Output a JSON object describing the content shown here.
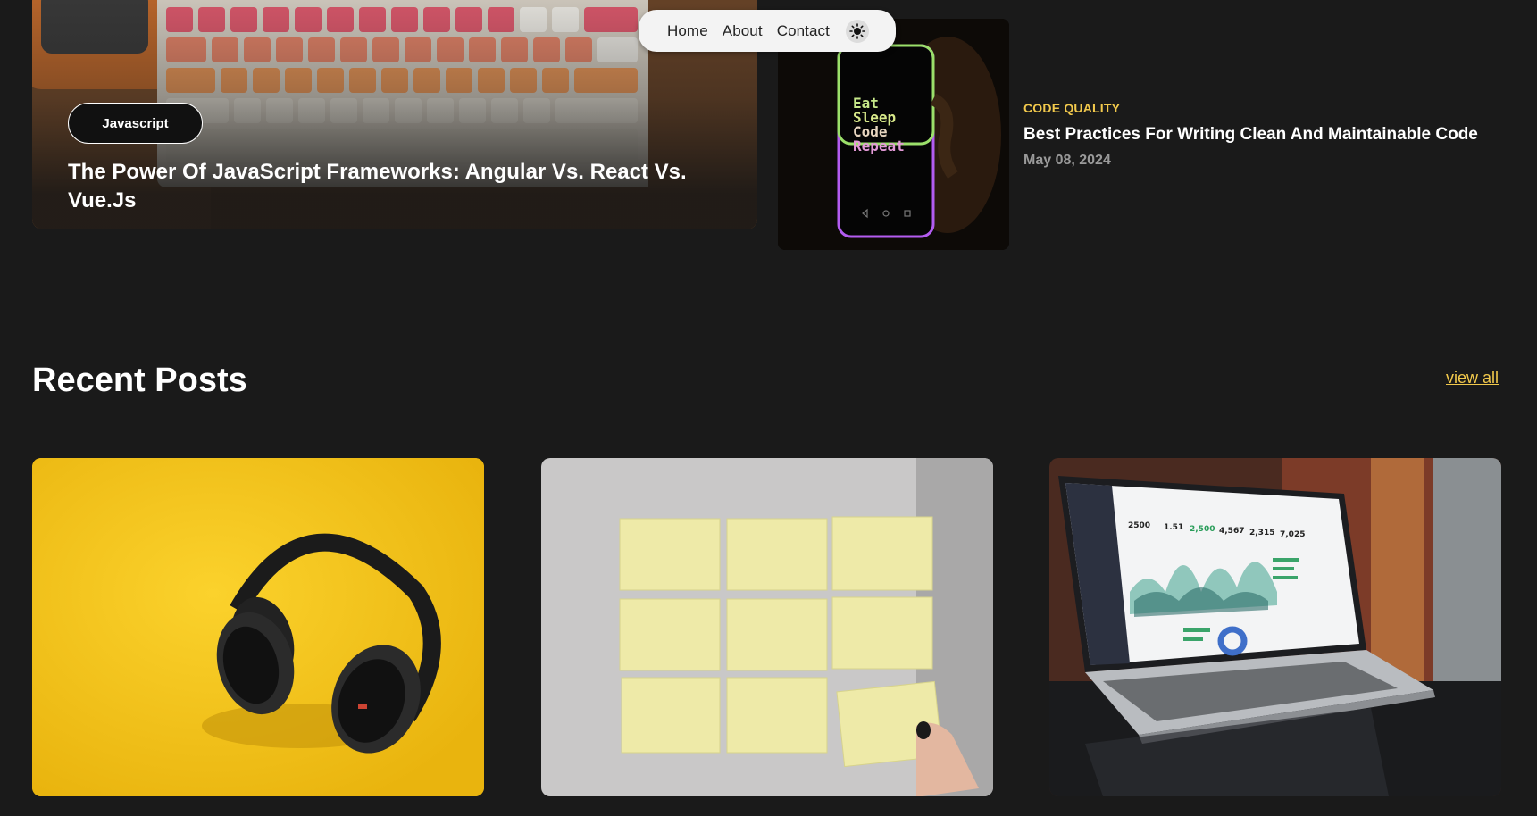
{
  "nav": {
    "items": [
      "Home",
      "About",
      "Contact"
    ],
    "theme_toggle_icon": "sun-icon"
  },
  "featured": {
    "tag": "Javascript",
    "title": "The Power Of JavaScript Frameworks: Angular Vs. React Vs. Vue.Js",
    "image": "keyboard-photo"
  },
  "side_post": {
    "category": "CODE QUALITY",
    "title": "Best Practices For Writing Clean And Maintainable Code",
    "date": "May 08, 2024",
    "image": "phone-eat-sleep-code-repeat-photo",
    "image_text": [
      "Eat",
      "Sleep",
      "Code",
      "Repeat"
    ]
  },
  "recent": {
    "title": "Recent Posts",
    "view_all": "view all",
    "cards": [
      {
        "image": "headphones-on-yellow-photo"
      },
      {
        "image": "sticky-notes-wall-photo"
      },
      {
        "image": "laptop-dashboard-photo",
        "screen_values": [
          "2500",
          "1.51",
          "2,500",
          "4,567",
          "2,315",
          "7,025"
        ]
      }
    ]
  },
  "colors": {
    "background": "#1a1a1a",
    "accent": "#f2c94c",
    "muted": "#9a9a9a",
    "nav_bg": "#f3f3f3"
  }
}
